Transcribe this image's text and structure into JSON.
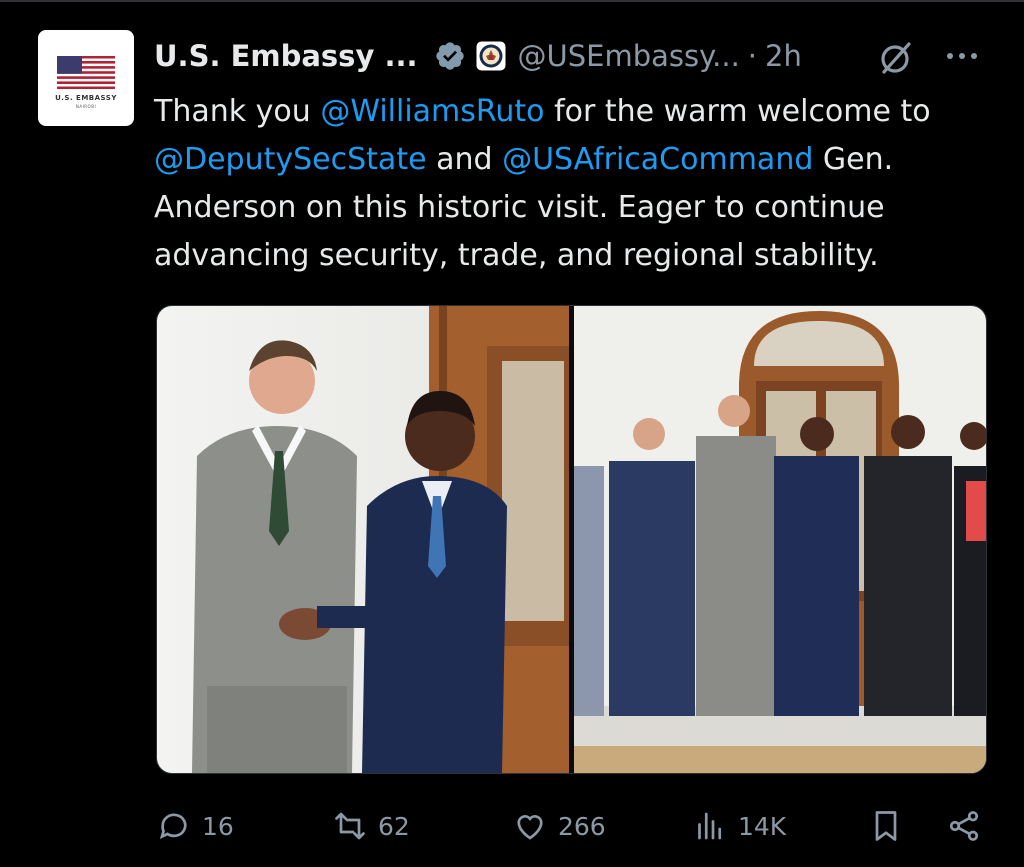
{
  "tweet": {
    "author_name": "U.S. Embassy ...",
    "handle": "@USEmbassy...",
    "separator": "·",
    "time": "2h",
    "avatar_caption_1": "U.S. EMBASSY",
    "avatar_caption_2": "NAIROBI",
    "text_segments": [
      {
        "t": "Thank you ",
        "mention": false
      },
      {
        "t": "@WilliamsRuto",
        "mention": true
      },
      {
        "t": " for the warm welcome to ",
        "mention": false
      },
      {
        "t": "@DeputySecState",
        "mention": true
      },
      {
        "t": " and ",
        "mention": false
      },
      {
        "t": "@USAfricaCommand",
        "mention": true
      },
      {
        "t": " Gen. Anderson on this historic visit. Eager to continue advancing security, trade, and regional stability.",
        "mention": false
      }
    ]
  },
  "actions": {
    "replies": "16",
    "reposts": "62",
    "likes": "266",
    "views": "14K"
  },
  "colors": {
    "background": "#000000",
    "text": "#e7e9ea",
    "secondary": "#8b98a5",
    "mention": "#1d9bf0",
    "verified": "#829aab"
  }
}
